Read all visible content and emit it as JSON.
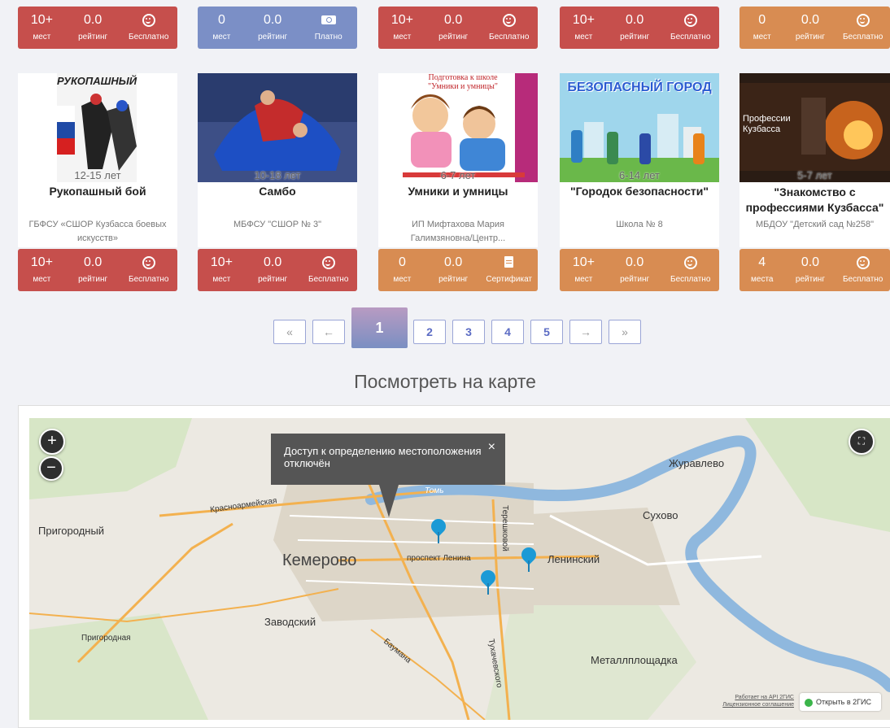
{
  "colors": {
    "red": "#c64f4c",
    "blue": "#7b8fc6",
    "orange": "#d88c52",
    "accent": "#5c6cc4"
  },
  "top_row": [
    {
      "color": "red",
      "places": "10+",
      "places_label": "мест",
      "rating": "0.0",
      "rating_label": "рейтинг",
      "price_icon": "smile-icon",
      "price_label": "Бесплатно"
    },
    {
      "color": "blue",
      "places": "0",
      "places_label": "мест",
      "rating": "0.0",
      "rating_label": "рейтинг",
      "price_icon": "money-icon",
      "price_label": "Платно"
    },
    {
      "color": "red",
      "places": "10+",
      "places_label": "мест",
      "rating": "0.0",
      "rating_label": "рейтинг",
      "price_icon": "smile-icon",
      "price_label": "Бесплатно"
    },
    {
      "color": "red",
      "places": "10+",
      "places_label": "мест",
      "rating": "0.0",
      "rating_label": "рейтинг",
      "price_icon": "smile-icon",
      "price_label": "Бесплатно"
    },
    {
      "color": "orange",
      "places": "0",
      "places_label": "мест",
      "rating": "0.0",
      "rating_label": "рейтинг",
      "price_icon": "smile-icon",
      "price_label": "Бесплатно"
    }
  ],
  "cards": [
    {
      "image_text": "РУКОПАШНЫЙ",
      "age": "12-15 лет",
      "title": "Рукопашный бой",
      "org": "ГБФСУ «СШОР Кузбасса боевых искусств»",
      "color": "red",
      "places": "10+",
      "places_label": "мест",
      "rating": "0.0",
      "rating_label": "рейтинг",
      "price_icon": "smile-icon",
      "price_label": "Бесплатно"
    },
    {
      "image_text": "",
      "age": "10-18 лет",
      "title": "Самбо",
      "org": "МБФСУ \"СШОР № 3\"",
      "color": "red",
      "places": "10+",
      "places_label": "мест",
      "rating": "0.0",
      "rating_label": "рейтинг",
      "price_icon": "smile-icon",
      "price_label": "Бесплатно"
    },
    {
      "image_text": "Подготовка к школе \"Умники и умницы\"",
      "age": "6-7 лет",
      "title": "Умники и умницы",
      "org": "ИП Мифтахова Мария Галимзяновна/Центр...",
      "color": "orange",
      "places": "0",
      "places_label": "мест",
      "rating": "0.0",
      "rating_label": "рейтинг",
      "price_icon": "document-icon",
      "price_label": "Сертификат"
    },
    {
      "image_text": "БЕЗОПАСНЫЙ ГОРОД",
      "age": "6-14 лет",
      "title": "\"Городок безопасности\"",
      "org": "Школа № 8",
      "color": "orange",
      "places": "10+",
      "places_label": "мест",
      "rating": "0.0",
      "rating_label": "рейтинг",
      "price_icon": "smile-icon",
      "price_label": "Бесплатно"
    },
    {
      "image_text": "Профессии Кузбасса",
      "age": "5-7 лет",
      "title": "\"Знакомство с профессиями Кузбасса\"",
      "org": "МБДОУ \"Детский сад №258\"",
      "color": "orange",
      "places": "4",
      "places_label": "места",
      "rating": "0.0",
      "rating_label": "рейтинг",
      "price_icon": "smile-icon",
      "price_label": "Бесплатно"
    }
  ],
  "pagination": {
    "first": "«",
    "prev": "←",
    "current": "1",
    "pages": [
      "2",
      "3",
      "4",
      "5"
    ],
    "next": "→",
    "last": "»"
  },
  "map_section": {
    "title": "Посмотреть на карте",
    "zoom_in": "+",
    "zoom_out": "−",
    "tooltip": "Доступ к определению местоположения отключён",
    "tooltip_close": "×",
    "labels": {
      "city": "Кемерово",
      "zhuravlevo": "Журавлево",
      "suhovo": "Сухово",
      "prigorodny": "Пригородный",
      "leninsky": "Ленинский",
      "zavodsky": "Заводский",
      "metall": "Металлплощадка",
      "krasnoarm": "Красноармейская",
      "tom": "Томь",
      "prospekt": "проспект Ленина",
      "tereshkova": "Терешковой",
      "prigorodnaya": "Пригородная",
      "baumana": "Баумана",
      "tuhach": "Тухачевского"
    },
    "api_note": "Работает на API 2ГИС",
    "license": "Лицензионное соглашение",
    "open_2gis": "Открыть в 2ГИС"
  }
}
